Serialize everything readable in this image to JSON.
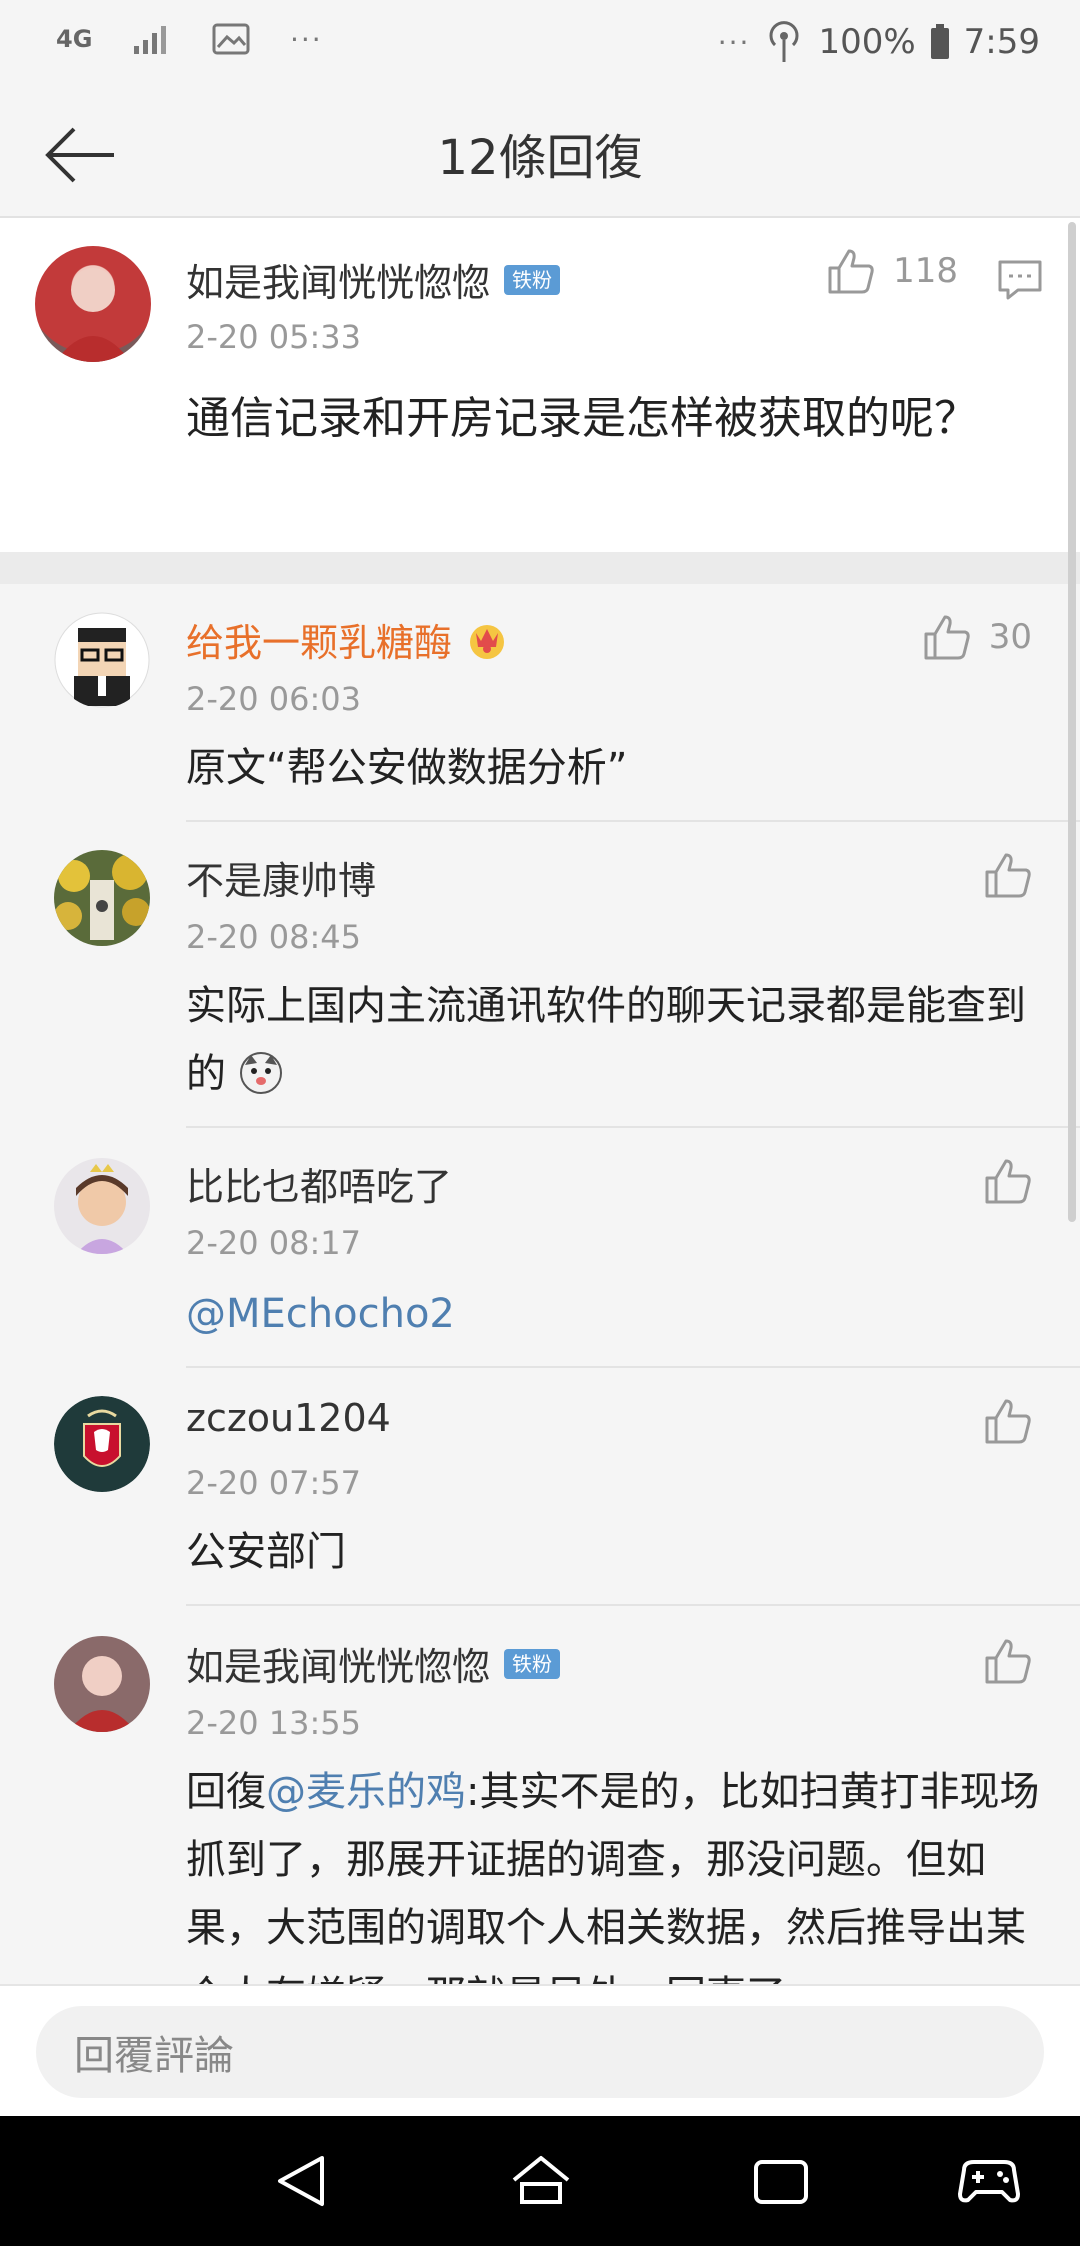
{
  "status_bar": {
    "network": "4G",
    "battery": "100%",
    "time": "7:59",
    "more_dots": "···"
  },
  "header": {
    "title": "12條回復"
  },
  "main_comment": {
    "username": "如是我闻恍恍惚惚",
    "badge": "铁粉",
    "timestamp": "2-20 05:33",
    "likes": "118",
    "text": "通信记录和开房记录是怎样被获取的呢？"
  },
  "replies": [
    {
      "username": "给我一颗乳糖酶",
      "timestamp": "2-20 06:03",
      "likes": "30",
      "text": "原文“帮公安做数据分析”"
    },
    {
      "username": "不是康帅博",
      "timestamp": "2-20 08:45",
      "likes": "",
      "text": "实际上国内主流通讯软件的聊天记录都是能查到的"
    },
    {
      "username": "比比乜都唔吃了",
      "timestamp": "2-20 08:17",
      "likes": "",
      "text": "@MEchocho2"
    },
    {
      "username": "zczou1204",
      "timestamp": "2-20 07:57",
      "likes": "",
      "text": "公安部门"
    },
    {
      "username": "如是我闻恍恍惚惚",
      "badge": "铁粉",
      "timestamp": "2-20 13:55",
      "likes": "",
      "text_prefix": "回復",
      "mention": "@麦乐的鸡",
      "text": ":其实不是的，比如扫黄打非现场抓到了，那展开证据的调查，那没问题。但如果，大范围的调取个人相关数据，然后推导出某个人有嫌疑，那就是另外一回事了。"
    }
  ],
  "reply_bar": {
    "placeholder": "回覆評論"
  },
  "icons": {
    "back": "arrow-left-icon",
    "like": "thumbs-up-icon",
    "comment": "comment-icon",
    "nav_back": "triangle-back-icon",
    "nav_home": "home-icon",
    "nav_recents": "recents-icon",
    "nav_game": "gamepad-icon"
  },
  "colors": {
    "mention": "#4f7fb0",
    "orange_name": "#e8702a",
    "badge": "#5b9bd5"
  }
}
